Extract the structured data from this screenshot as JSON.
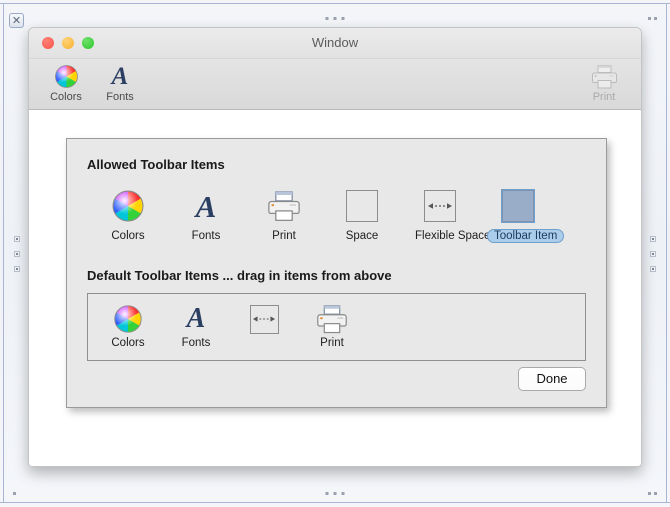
{
  "outer_frame": {
    "close_label": "✕",
    "grip_icon": "resize-grip"
  },
  "window": {
    "title": "Window",
    "traffic_lights": [
      {
        "name": "close",
        "color": "#f9534a"
      },
      {
        "name": "minimize",
        "color": "#f7b12d"
      },
      {
        "name": "zoom",
        "color": "#2bc62b"
      }
    ],
    "toolbar": {
      "left_items": [
        {
          "label": "Colors",
          "icon": "color-wheel-icon",
          "disabled": false
        },
        {
          "label": "Fonts",
          "icon": "font-a-icon",
          "disabled": false
        }
      ],
      "right_items": [
        {
          "label": "Print",
          "icon": "printer-icon",
          "disabled": true
        }
      ]
    }
  },
  "sheet": {
    "allowed_heading": "Allowed Toolbar Items",
    "allowed_items": [
      {
        "label": "Colors",
        "icon": "color-wheel-icon",
        "selected": false
      },
      {
        "label": "Fonts",
        "icon": "font-a-icon",
        "selected": false
      },
      {
        "label": "Print",
        "icon": "printer-icon",
        "selected": false
      },
      {
        "label": "Space",
        "icon": "space-box-icon",
        "selected": false
      },
      {
        "label": "Flexible Space",
        "icon": "flexible-space-icon",
        "selected": false
      },
      {
        "label": "Toolbar Item",
        "icon": "generic-item-icon",
        "selected": true
      }
    ],
    "default_heading": "Default Toolbar Items ... drag in items from above",
    "default_items": [
      {
        "label": "Colors",
        "icon": "color-wheel-icon"
      },
      {
        "label": "Fonts",
        "icon": "font-a-icon"
      },
      {
        "label": "",
        "icon": "flexible-space-icon"
      },
      {
        "label": "Print",
        "icon": "printer-icon"
      }
    ],
    "done_label": "Done",
    "selection_color": "#aacdec"
  }
}
